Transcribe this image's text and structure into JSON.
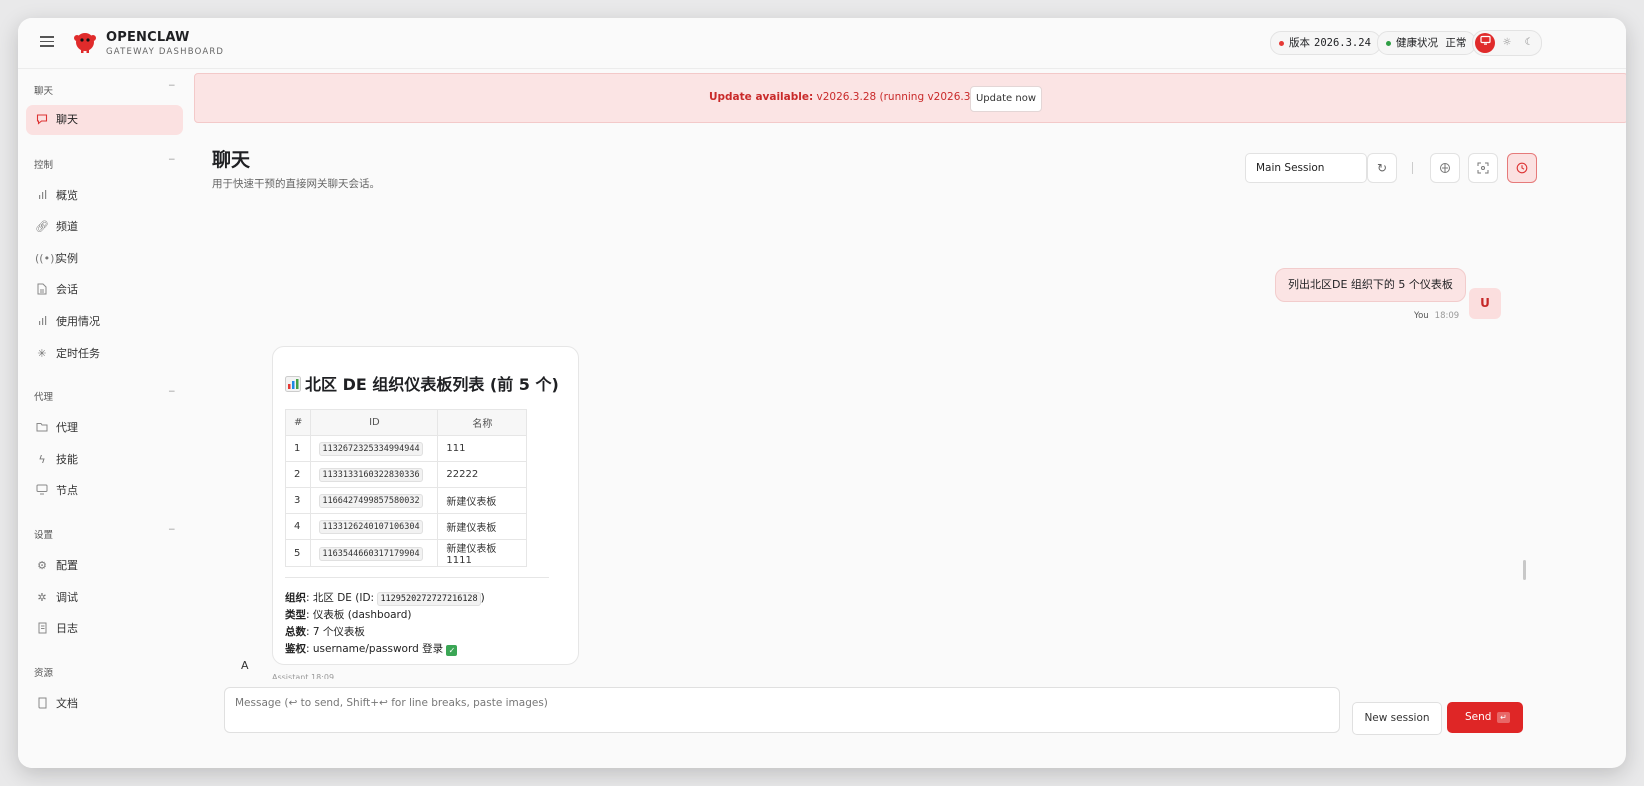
{
  "header": {
    "brand_title": "OPENCLAW",
    "brand_subtitle": "GATEWAY DASHBOARD",
    "version_label": "版本",
    "version_value": "2026.3.24",
    "health_label": "健康状况",
    "health_value": "正常",
    "status_colors": {
      "version_dot": "#e53935",
      "health_dot": "#2e9e44"
    }
  },
  "sidebar": {
    "sections": [
      {
        "title": "聊天",
        "items": [
          {
            "label": "聊天",
            "icon": "chat-bubble-icon",
            "active": true
          }
        ]
      },
      {
        "title": "控制",
        "items": [
          {
            "label": "概览",
            "icon": "bar-chart-icon"
          },
          {
            "label": "频道",
            "icon": "link-icon"
          },
          {
            "label": "实例",
            "icon": "broadcast-icon"
          },
          {
            "label": "会话",
            "icon": "document-icon"
          },
          {
            "label": "使用情况",
            "icon": "bar-chart-icon"
          },
          {
            "label": "定时任务",
            "icon": "loading-icon"
          }
        ]
      },
      {
        "title": "代理",
        "items": [
          {
            "label": "代理",
            "icon": "folder-icon"
          },
          {
            "label": "技能",
            "icon": "lightning-icon"
          },
          {
            "label": "节点",
            "icon": "monitor-icon"
          }
        ]
      },
      {
        "title": "设置",
        "items": [
          {
            "label": "配置",
            "icon": "gear-icon"
          },
          {
            "label": "调试",
            "icon": "bug-icon"
          },
          {
            "label": "日志",
            "icon": "scroll-icon"
          }
        ]
      },
      {
        "title": "资源",
        "items": [
          {
            "label": "文档",
            "icon": "book-icon"
          }
        ]
      }
    ]
  },
  "banner": {
    "lead": "Update available:",
    "text": " v2026.3.28 (running v2026.3.24).",
    "button": "Update now"
  },
  "page": {
    "title": "聊天",
    "subtitle": "用于快速干预的直接网关聊天会话。",
    "session_select": "Main Session"
  },
  "chat": {
    "user_message": "列出北区DE 组织下的 5 个仪表板",
    "user_avatar": "U",
    "user_name": "You",
    "user_time": "18:09",
    "assistant_avatar": "A",
    "assistant_meta": "Assistant 18:09",
    "card": {
      "title": "北区 DE 组织仪表板列表 (前 5 个)",
      "columns": [
        "#",
        "ID",
        "名称"
      ],
      "rows": [
        [
          "1",
          "1132672325334994944",
          "111"
        ],
        [
          "2",
          "1133133160322830336",
          "22222"
        ],
        [
          "3",
          "1166427499857580032",
          "新建仪表板"
        ],
        [
          "4",
          "1133126240107106304",
          "新建仪表板"
        ],
        [
          "5",
          "1163544660317179904",
          "新建仪表板 1111"
        ]
      ],
      "org_label": "组织",
      "org_value": ": 北区 DE (ID: ",
      "org_id": "1129520272727216128",
      "org_close": ")",
      "type_label": "类型",
      "type_value": ": 仪表板 (dashboard)",
      "total_label": "总数",
      "total_value": ": 7 个仪表板",
      "auth_label": "鉴权",
      "auth_value": ": username/password 登录 "
    }
  },
  "composer": {
    "placeholder": "Message (↩ to send, Shift+↩ for line breaks, paste images)",
    "new_session": "New session",
    "send": "Send"
  },
  "theme": {
    "accent": "#df2626"
  }
}
